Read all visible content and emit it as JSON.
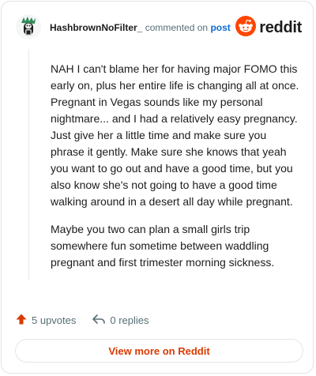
{
  "header": {
    "username": "HashbrownNoFilter_",
    "commented_text": "commented on",
    "post_link": "post",
    "brand_name": "reddit"
  },
  "comment": {
    "paragraphs": [
      "NAH I can't blame her for having major FOMO this early on, plus her entire life is changing all at once. Pregnant in Vegas sounds like my personal nightmare... and I had a relatively easy pregnancy. Just give her a little time and make sure you phrase it gently. Make sure she knows that yeah you want to go out and have a good time, but you also know she's not going to have a good time walking around in a desert all day while pregnant.",
      "Maybe you two can plan a small girls trip somewhere fun sometime between waddling pregnant and first trimester morning sickness."
    ]
  },
  "actions": {
    "upvotes": "5 upvotes",
    "replies": "0 replies"
  },
  "footer": {
    "view_more": "View more on Reddit"
  },
  "colors": {
    "brand_orange": "#ff4500",
    "upvote_orange": "#d93a00",
    "link_blue": "#0b6bd1",
    "meta_gray": "#576f76"
  },
  "icons": {
    "avatar": "avatar-icon",
    "brand": "reddit-logo-icon",
    "upvote": "upvote-arrow-icon",
    "reply": "reply-arrow-icon"
  }
}
